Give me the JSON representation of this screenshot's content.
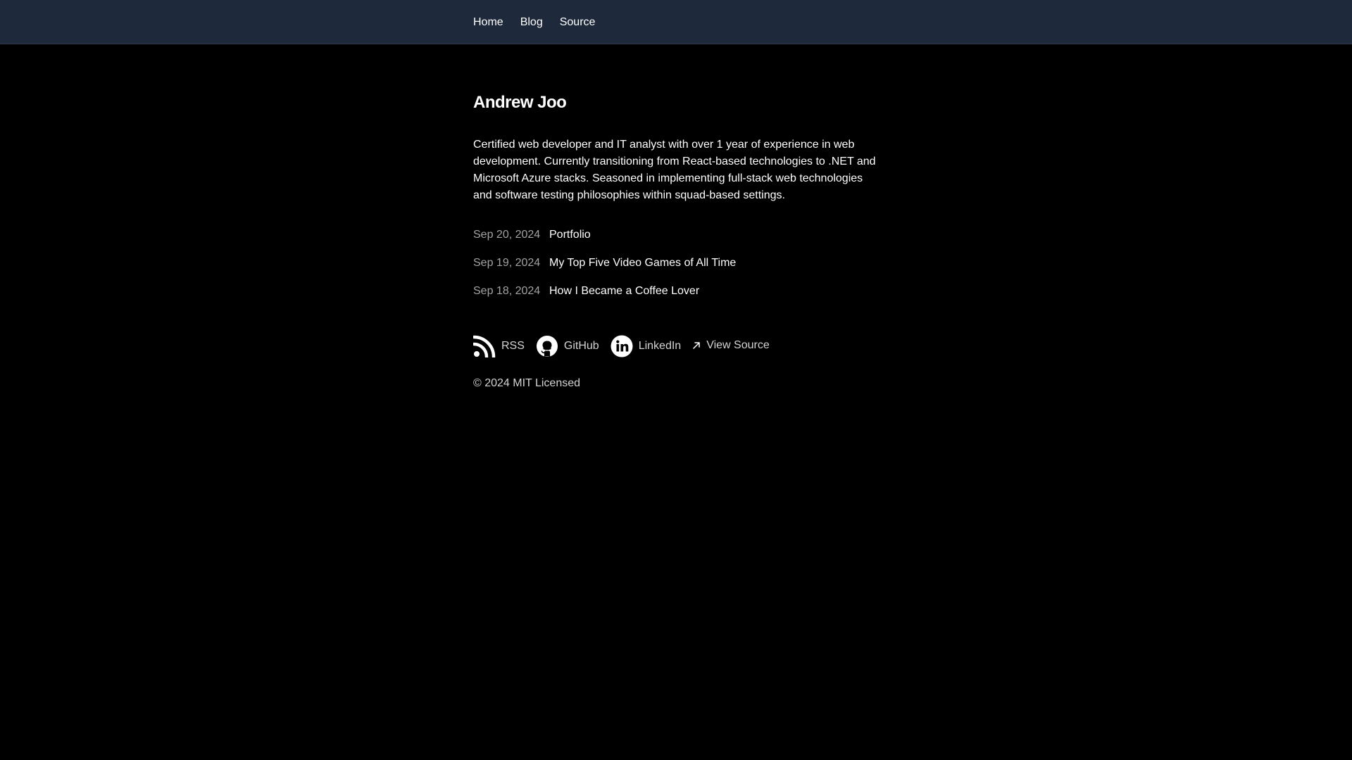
{
  "nav": {
    "items": [
      {
        "label": "Home"
      },
      {
        "label": "Blog"
      },
      {
        "label": "Source"
      }
    ]
  },
  "profile": {
    "name": "Andrew Joo",
    "bio": "Certified web developer and IT analyst with over 1 year of experience in web development. Currently transitioning from React-based technologies to .NET and Microsoft Azure stacks. Seasoned in implementing full-stack web technologies and software testing philosophies within squad-based settings."
  },
  "posts": [
    {
      "date": "Sep 20, 2024",
      "title": "Portfolio"
    },
    {
      "date": "Sep 19, 2024",
      "title": "My Top Five Video Games of All Time"
    },
    {
      "date": "Sep 18, 2024",
      "title": "How I Became a Coffee Lover"
    }
  ],
  "footer": {
    "links": [
      {
        "label": "RSS",
        "icon": "rss-icon"
      },
      {
        "label": "GitHub",
        "icon": "github-icon"
      },
      {
        "label": "LinkedIn",
        "icon": "linkedin-icon"
      },
      {
        "label": "View Source",
        "icon": "arrow-up-right-icon"
      }
    ],
    "copyright": "© 2024 MIT Licensed"
  },
  "colors": {
    "background": "#000000",
    "topbar": "#1e293b",
    "text": "#ffffff",
    "muted": "#a3a3a3"
  }
}
